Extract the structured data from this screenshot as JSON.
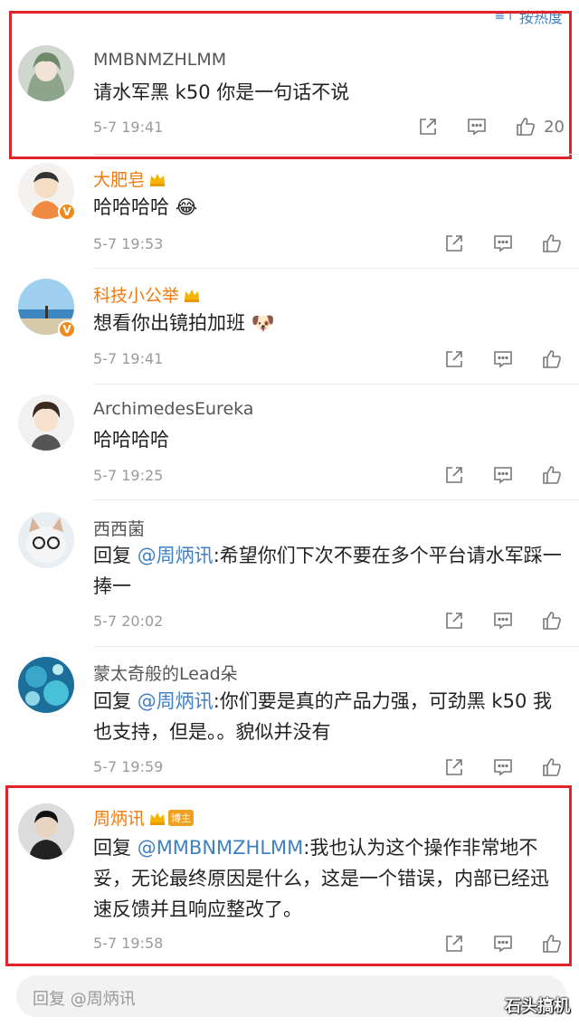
{
  "sort": {
    "label": "按热度"
  },
  "comments": [
    {
      "name": "MMBNMZHLMM",
      "text": "请水军黑 k50 你是一句话不说",
      "time": "5-7 19:41",
      "likes": "20"
    },
    {
      "name": "大肥皂",
      "text": "哈哈哈哈",
      "time": "5-7 19:53"
    },
    {
      "name": "科技小公举",
      "text": "想看你出镜拍加班",
      "time": "5-7 19:41"
    },
    {
      "name": "ArchimedesEureka",
      "text": "哈哈哈哈",
      "time": "5-7 19:25"
    },
    {
      "name": "西西菌",
      "prefix": "回复 ",
      "mention": "@周炳讯",
      "text": ":希望你们下次不要在多个平台请水军踩一捧一",
      "time": "5-7 20:02"
    },
    {
      "name": "蒙太奇般的Lead朵",
      "prefix": "回复 ",
      "mention": "@周炳讯",
      "text": ":你们要是真的产品力强，可劲黑 k50 我也支持，但是。。貌似并没有",
      "time": "5-7 19:59"
    },
    {
      "name": "周炳讯",
      "badge": "博主",
      "prefix": "回复 ",
      "mention": "@MMBNMZHLMM",
      "text": ":我也认为这个操作非常地不妥，无论最终原因是什么，这是一个错误，内部已经迅速反馈并且响应整改了。",
      "time": "5-7 19:58"
    }
  ],
  "reply_bar": {
    "placeholder": "回复 @周炳讯"
  },
  "watermark": "石头搞机",
  "colors": {
    "accent_blue": "#3f7fc4",
    "name_orange": "#f07a10",
    "highlight_red": "#e0242b"
  }
}
